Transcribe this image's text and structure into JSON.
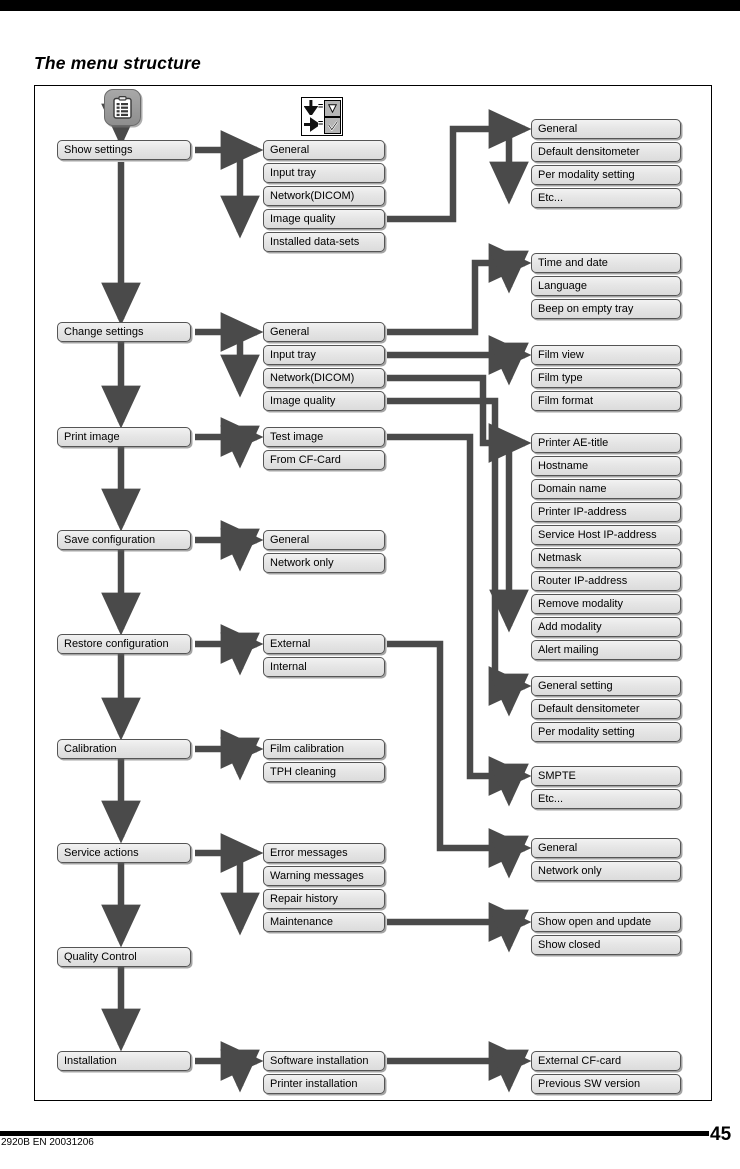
{
  "page": {
    "title": "The menu structure",
    "footer_code": "2920B EN 20031206",
    "page_number": "45"
  },
  "legend": {
    "down_arrow_icon": "down-arrow-icon",
    "down_key_glyph": "▽",
    "right_arrow_icon": "right-arrow-icon",
    "right_key_glyph": "✓",
    "equals": "=",
    "equals2": "="
  },
  "root_icon": "menu-list-icon",
  "colors": {
    "connector": "#4a4a4a",
    "box_fill": "#e6e6e6",
    "box_border": "#555555",
    "icon_fill": "#9a9a9a",
    "rule": "#000000"
  },
  "menu": {
    "level1": [
      {
        "label": "Show settings"
      },
      {
        "label": "Change settings"
      },
      {
        "label": "Print image"
      },
      {
        "label": "Save configuration"
      },
      {
        "label": "Restore configuration"
      },
      {
        "label": "Calibration"
      },
      {
        "label": "Service actions"
      },
      {
        "label": "Quality Control"
      },
      {
        "label": "Installation"
      }
    ],
    "level2": {
      "show_settings": [
        "General",
        "Input tray",
        "Network(DICOM)",
        "Image quality",
        "Installed data-sets"
      ],
      "change_settings": [
        "General",
        "Input tray",
        "Network(DICOM)",
        "Image quality"
      ],
      "print_image": [
        "Test image",
        "From CF-Card"
      ],
      "save_configuration": [
        "General",
        "Network only"
      ],
      "restore_configuration": [
        "External",
        "Internal"
      ],
      "calibration": [
        "Film calibration",
        "TPH cleaning"
      ],
      "service_actions": [
        "Error messages",
        "Warning messages",
        "Repair history",
        "Maintenance"
      ],
      "installation": [
        "Software installation",
        "Printer installation"
      ]
    },
    "level3": {
      "show_image_quality": [
        "General",
        "Default densitometer",
        "Per modality setting",
        "Etc..."
      ],
      "change_general": [
        "Time and date",
        "Language",
        "Beep on empty tray"
      ],
      "change_input_tray": [
        "Film view",
        "Film type",
        "Film format"
      ],
      "change_network": [
        "Printer AE-title",
        "Hostname",
        "Domain name",
        "Printer IP-address",
        "Service Host IP-address",
        "Netmask",
        "Router IP-address",
        "Remove modality",
        "Add modality",
        "Alert mailing"
      ],
      "change_image_quality": [
        "General setting",
        "Default densitometer",
        "Per modality setting"
      ],
      "test_image": [
        "SMPTE",
        "Etc..."
      ],
      "restore_external": [
        "General",
        "Network only"
      ],
      "maintenance": [
        "Show open and update",
        "Show closed"
      ],
      "software_installation": [
        "External CF-card",
        "Previous SW version"
      ]
    }
  }
}
